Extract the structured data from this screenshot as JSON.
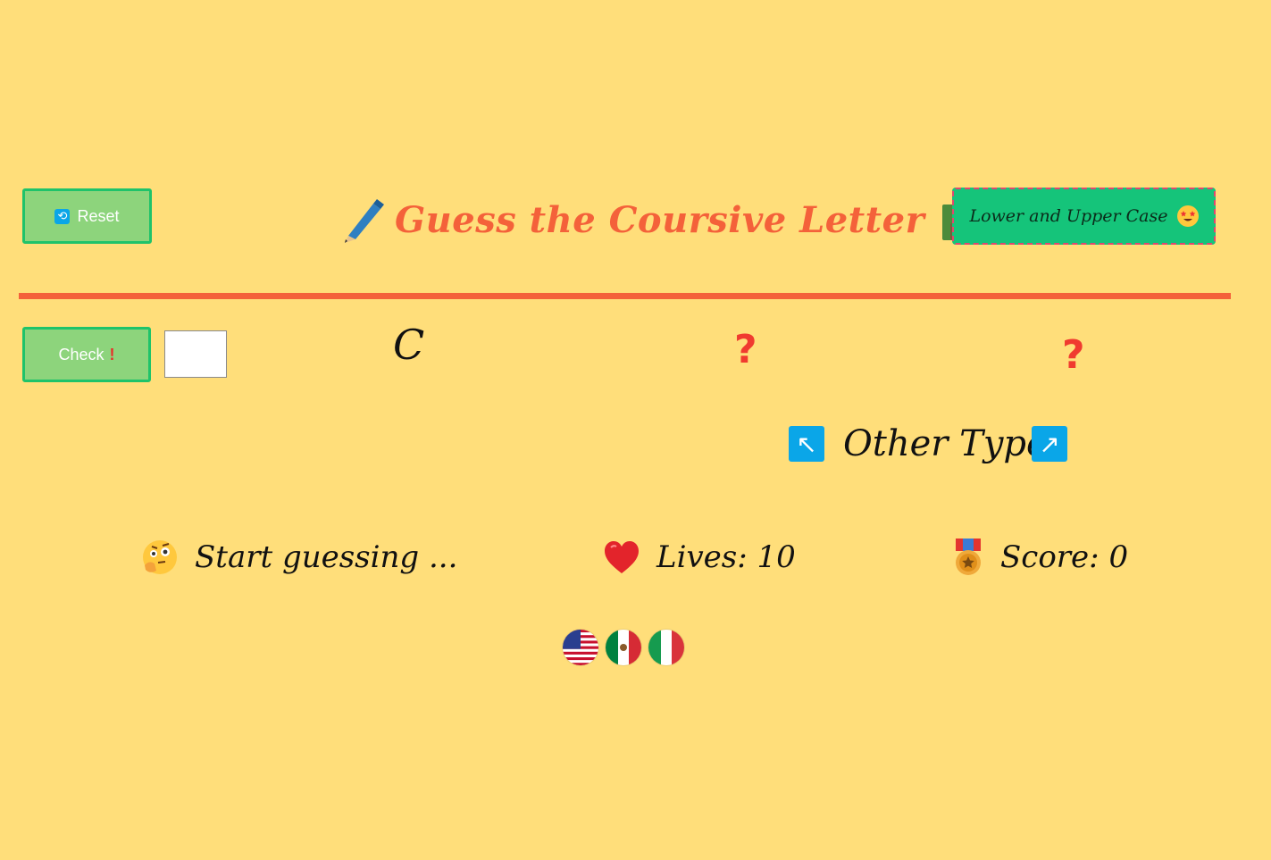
{
  "header": {
    "reset_label": "Reset",
    "title": "Guess the Coursive Letter",
    "mode_label": "Lower and Upper Case"
  },
  "game": {
    "check_label": "Check",
    "answer_value": "",
    "cursive_letter": "C",
    "hidden_slot_1": "?",
    "hidden_slot_2": "?",
    "other_types_label": "Other Types"
  },
  "status": {
    "message": "Start guessing ...",
    "lives": "Lives: 10",
    "score": "Score: 0"
  },
  "languages": [
    "English (US)",
    "Spanish (MX)",
    "Italian"
  ],
  "colors": {
    "background": "#ffde7a",
    "accent": "#f4613a",
    "button_green": "#8dd47c",
    "mode_button": "#15c47a",
    "icon_blue": "#0aa6e8"
  },
  "icons": {
    "title_left": "pen-icon",
    "title_right": "teacher-icon",
    "mode": "star-struck-icon",
    "reset": "repeat-icon",
    "check": "exclamation-icon",
    "other_left": "arrow-up-left-icon",
    "other_right": "arrow-up-right-icon",
    "message": "thinking-face-icon",
    "lives": "heart-icon",
    "score": "medal-icon"
  }
}
